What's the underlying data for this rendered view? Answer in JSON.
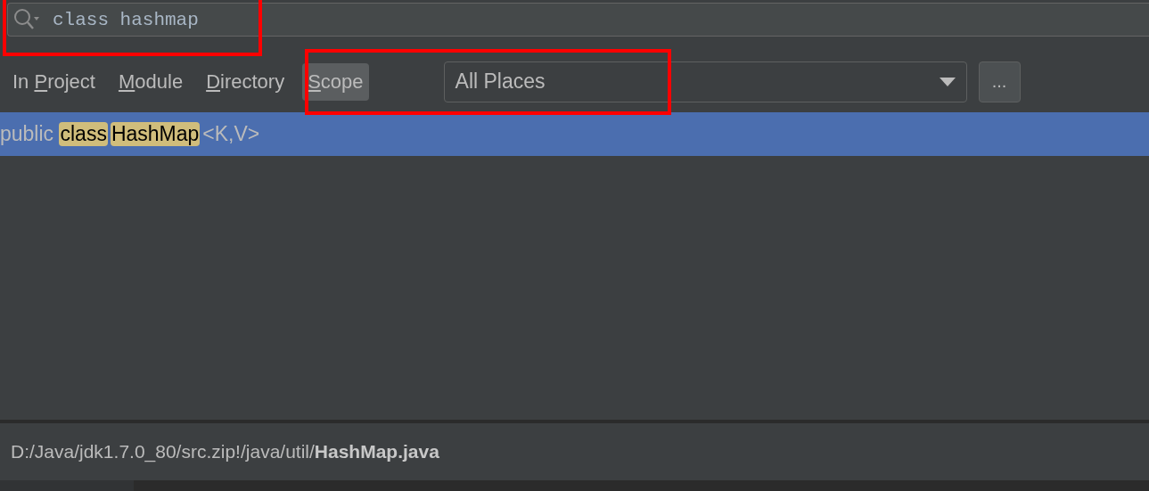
{
  "search": {
    "value": "class hashmap"
  },
  "tabs": [
    {
      "before": "In ",
      "key": "P",
      "after": "roject",
      "selected": false
    },
    {
      "key": "M",
      "after": "odule",
      "selected": false
    },
    {
      "key": "D",
      "after": "irectory",
      "selected": false
    },
    {
      "key": "S",
      "after": "cope",
      "selected": true
    }
  ],
  "scope_dropdown": {
    "value": "All Places"
  },
  "more_button": "...",
  "results": [
    {
      "selected": true,
      "parts": [
        {
          "text": "public ",
          "match": false
        },
        {
          "text": "class",
          "match": true
        },
        {
          "text": "HashMap",
          "match": true
        },
        {
          "text": "<K,V>",
          "match": false
        }
      ]
    }
  ],
  "file_path": "D:/Java/jdk1.7.0_80/src.zip!/java/util/**HashMap.java**",
  "annotations": [
    {
      "kind": "frame"
    },
    {
      "kind": "frame"
    }
  ]
}
